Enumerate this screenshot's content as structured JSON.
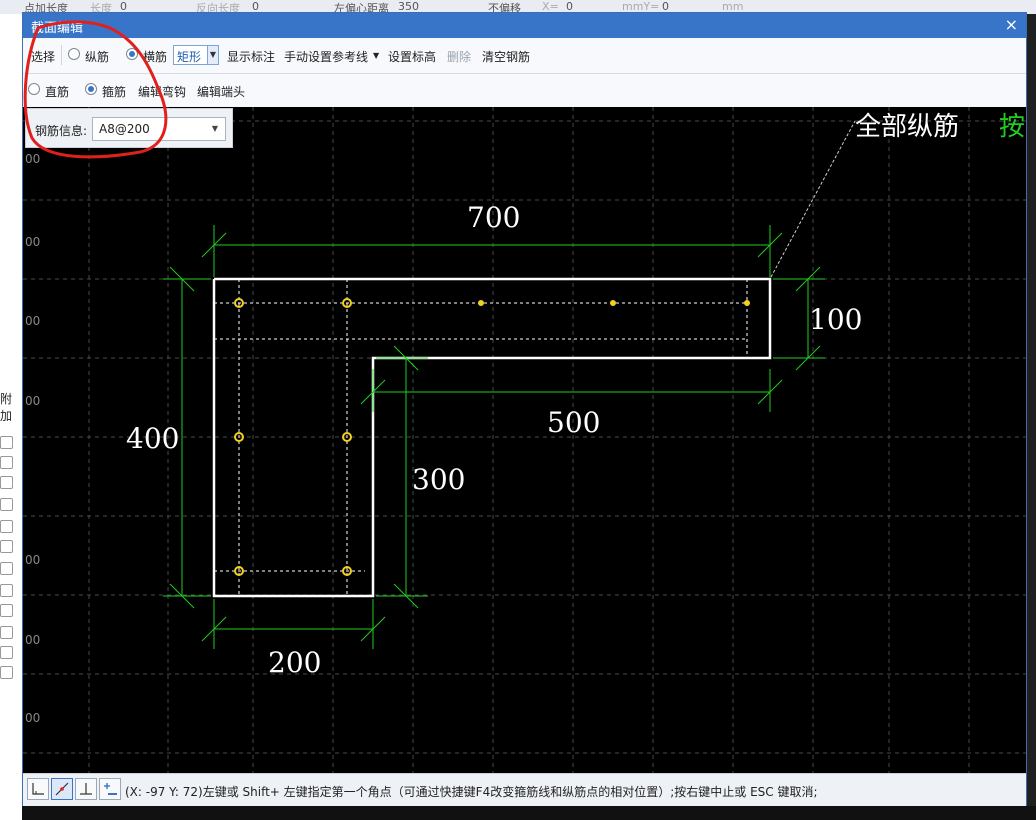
{
  "background": {
    "top_strip": [
      "点加长度",
      "长度",
      "0",
      "反向长度",
      "0",
      "左偏心距离",
      "350",
      "不偏移",
      "X=",
      "0",
      "mmY=",
      "0",
      "mm"
    ],
    "left_labels": [
      "00",
      "00",
      "00",
      "00",
      "00",
      "00",
      "00"
    ],
    "left_side_text": "附加"
  },
  "dialog": {
    "title": "截面编辑",
    "close_glyph": "×"
  },
  "toolbar1": {
    "select_label": "选择",
    "longitudinal_label": "纵筋",
    "transverse_label": "横筋",
    "shape_value": "矩形",
    "show_dimension_label": "显示标注",
    "manual_ref_line_label": "手动设置参考线",
    "set_elevation_label": "设置标高",
    "delete_label": "删除",
    "clear_rebar_label": "清空钢筋"
  },
  "toolbar2": {
    "straight_label": "直筋",
    "stirrup_label": "箍筋",
    "edit_hook_label": "编辑弯钩",
    "edit_end_label": "编辑端头"
  },
  "info_panel": {
    "label": "钢筋信息:",
    "value": "A8@200"
  },
  "canvas": {
    "overlay_text_white": "全部纵筋",
    "overlay_text_green": "按",
    "dimensions": {
      "top_width": "700",
      "right_height": "100",
      "inner_width": "500",
      "left_height": "400",
      "inner_height": "300",
      "bottom_width": "200"
    }
  },
  "status": {
    "text": "(X: -97 Y: 72)左键或 Shift+ 左键指定第一个角点（可通过快捷键F4改变箍筋线和纵筋点的相对位置）;按右键中止或 ESC 键取消;"
  },
  "colors": {
    "accent": "#3875c9",
    "dimension": "#22cc22",
    "outline": "#ffffff",
    "rebar_point": "#f2d21b",
    "annotation": "#e0201a"
  },
  "icons": [
    "close-icon",
    "dropdown-arrow-icon",
    "snap-corner-icon",
    "snap-line-icon",
    "snap-perpendicular-icon",
    "add-point-icon"
  ]
}
